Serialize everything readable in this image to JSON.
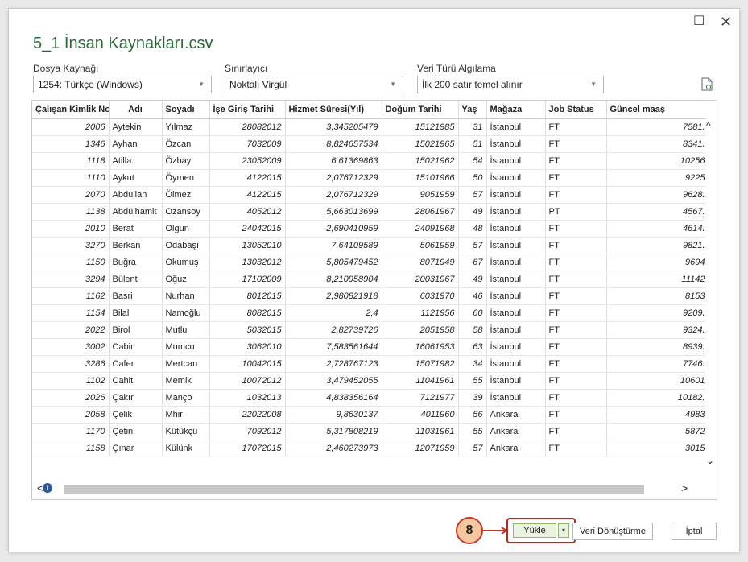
{
  "window": {
    "maximize_symbol": "☐",
    "close_symbol": "✕"
  },
  "title": "5_1 İnsan Kaynakları.csv",
  "file_origin": {
    "label": "Dosya Kaynağı",
    "value": "1254: Türkçe (Windows)"
  },
  "delimiter": {
    "label": "Sınırlayıcı",
    "value": "Noktalı Virgül"
  },
  "type_detection": {
    "label": "Veri Türü Algılama",
    "value": "İlk 200 satır temel alınır"
  },
  "icons": {
    "refresh": "document-refresh-icon",
    "info": "info-icon"
  },
  "table": {
    "headers": [
      "Çalışan Kimlik No:",
      "Adı",
      "Soyadı",
      "İşe Giriş Tarihi",
      "Hizmet Süresi(Yıl)",
      "Doğum Tarihi",
      "Yaş",
      "Mağaza",
      "Job Status",
      "Güncel maaş"
    ],
    "rows": [
      [
        "2006",
        "Aytekin",
        "Yılmaz",
        "28082012",
        "3,345205479",
        "15121985",
        "31",
        "İstanbul",
        "FT",
        "7581."
      ],
      [
        "1346",
        "Ayhan",
        "Özcan",
        "7032009",
        "8,824657534",
        "15021965",
        "51",
        "İstanbul",
        "FT",
        "8341."
      ],
      [
        "1118",
        "Atilla",
        "Özbay",
        "23052009",
        "6,61369863",
        "15021962",
        "54",
        "İstanbul",
        "FT",
        "10256"
      ],
      [
        "1110",
        "Aykut",
        "Öymen",
        "4122015",
        "2,076712329",
        "15101966",
        "50",
        "İstanbul",
        "FT",
        "9225"
      ],
      [
        "2070",
        "Abdullah",
        "Ölmez",
        "4122015",
        "2,076712329",
        "9051959",
        "57",
        "İstanbul",
        "FT",
        "9628."
      ],
      [
        "1138",
        "Abdülhamit",
        "Ozansoy",
        "4052012",
        "5,663013699",
        "28061967",
        "49",
        "İstanbul",
        "PT",
        "4567."
      ],
      [
        "2010",
        "Berat",
        "Olgun",
        "24042015",
        "2,690410959",
        "24091968",
        "48",
        "İstanbul",
        "FT",
        "4614."
      ],
      [
        "3270",
        "Berkan",
        "Odabaşı",
        "13052010",
        "7,64109589",
        "5061959",
        "57",
        "İstanbul",
        "FT",
        "9821."
      ],
      [
        "1150",
        "Buğra",
        "Okumuş",
        "13032012",
        "5,805479452",
        "8071949",
        "67",
        "İstanbul",
        "FT",
        "9694"
      ],
      [
        "3294",
        "Bülent",
        "Oğuz",
        "17102009",
        "8,210958904",
        "20031967",
        "49",
        "İstanbul",
        "FT",
        "11142"
      ],
      [
        "1162",
        "Basri",
        "Nurhan",
        "8012015",
        "2,980821918",
        "6031970",
        "46",
        "İstanbul",
        "FT",
        "8153"
      ],
      [
        "1154",
        "Bilal",
        "Namoğlu",
        "8082015",
        "2,4",
        "1121956",
        "60",
        "İstanbul",
        "FT",
        "9209."
      ],
      [
        "2022",
        "Birol",
        "Mutlu",
        "5032015",
        "2,82739726",
        "2051958",
        "58",
        "İstanbul",
        "FT",
        "9324."
      ],
      [
        "3002",
        "Cabir",
        "Mumcu",
        "3062010",
        "7,583561644",
        "16061953",
        "63",
        "İstanbul",
        "FT",
        "8939."
      ],
      [
        "3286",
        "Cafer",
        "Mertcan",
        "10042015",
        "2,728767123",
        "15071982",
        "34",
        "İstanbul",
        "FT",
        "7746."
      ],
      [
        "1102",
        "Cahit",
        "Memik",
        "10072012",
        "3,479452055",
        "11041961",
        "55",
        "İstanbul",
        "FT",
        "10601"
      ],
      [
        "2026",
        "Çakır",
        "Manço",
        "1032013",
        "4,838356164",
        "7121977",
        "39",
        "İstanbul",
        "FT",
        "10182."
      ],
      [
        "2058",
        "Çelik",
        "Mhir",
        "22022008",
        "9,8630137",
        "4011960",
        "56",
        "Ankara",
        "FT",
        "4983"
      ],
      [
        "1170",
        "Çetin",
        "Kütükçü",
        "7092012",
        "5,317808219",
        "11031961",
        "55",
        "Ankara",
        "FT",
        "5872"
      ],
      [
        "1158",
        "Çınar",
        "Külünk",
        "17072015",
        "2,460273973",
        "12071959",
        "57",
        "Ankara",
        "FT",
        "3015"
      ]
    ]
  },
  "scroll": {
    "up": "^",
    "down": "⌄",
    "left": "<",
    "right": ">"
  },
  "callout": {
    "number": "8"
  },
  "buttons": {
    "load": "Yükle",
    "load_split": "▾",
    "transform": "Veri Dönüştürme",
    "cancel": "İptal"
  },
  "colors": {
    "title": "#2d6a3a",
    "load_highlight": "#b02b20",
    "badge_fill": "#f7c79f"
  }
}
